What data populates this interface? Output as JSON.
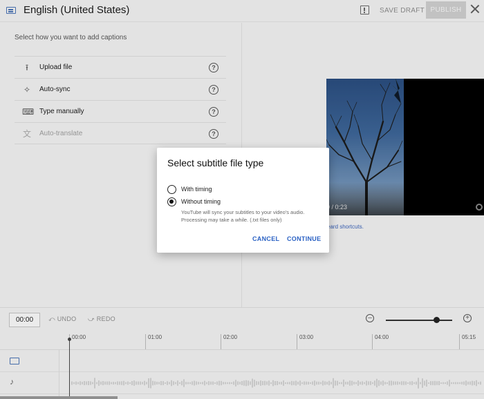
{
  "header": {
    "title": "English (United States)",
    "save_draft_label": "SAVE DRAFT",
    "publish_label": "PUBLISH"
  },
  "left_panel": {
    "instruction": "Select how you want to add captions",
    "options": [
      {
        "label": "Upload file",
        "icon": "upload-icon",
        "enabled": true
      },
      {
        "label": "Auto-sync",
        "icon": "sparkle-icon",
        "enabled": true
      },
      {
        "label": "Type manually",
        "icon": "keyboard-icon",
        "enabled": true
      },
      {
        "label": "Auto-translate",
        "icon": "translate-icon",
        "enabled": false
      }
    ]
  },
  "video": {
    "time_display": "0 / 0:23",
    "shortcuts_text": "eard shortcuts."
  },
  "toolbar": {
    "timecode": "00:00",
    "undo_label": "UNDO",
    "redo_label": "REDO",
    "zoom_level": 0.77
  },
  "timeline": {
    "ticks": [
      "00:00",
      "01:00",
      "02:00",
      "03:00",
      "04:00",
      "05:15"
    ]
  },
  "dialog": {
    "title": "Select subtitle file type",
    "options": [
      {
        "label": "With timing",
        "selected": false
      },
      {
        "label": "Without timing",
        "selected": true
      }
    ],
    "description": "YouTube will sync your subtitles to your video's audio. Processing may take a while. (.txt files only)",
    "cancel_label": "CANCEL",
    "continue_label": "CONTINUE"
  },
  "colors": {
    "accent": "#2b62c4",
    "background": "#f2f2f2",
    "caption_icon": "#4a73b5"
  }
}
